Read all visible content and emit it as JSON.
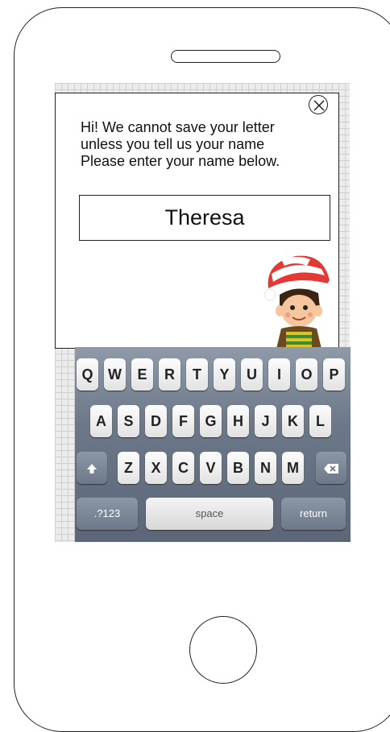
{
  "dialog": {
    "message_lines": [
      "Hi! We cannot save your letter",
      "unless you tell us your name",
      "Please enter your name below."
    ],
    "name_value": "Theresa"
  },
  "keyboard": {
    "row1": [
      "Q",
      "W",
      "E",
      "R",
      "T",
      "Y",
      "U",
      "I",
      "O",
      "P"
    ],
    "row2": [
      "A",
      "S",
      "D",
      "F",
      "G",
      "H",
      "J",
      "K",
      "L"
    ],
    "row3": [
      "Z",
      "X",
      "C",
      "V",
      "B",
      "N",
      "M"
    ],
    "numbers_label": ".?123",
    "space_label": "space",
    "return_label": "return"
  },
  "icons": {
    "close": "close-icon",
    "shift": "shift-icon",
    "backspace": "backspace-icon",
    "elf": "elf-illustration"
  }
}
